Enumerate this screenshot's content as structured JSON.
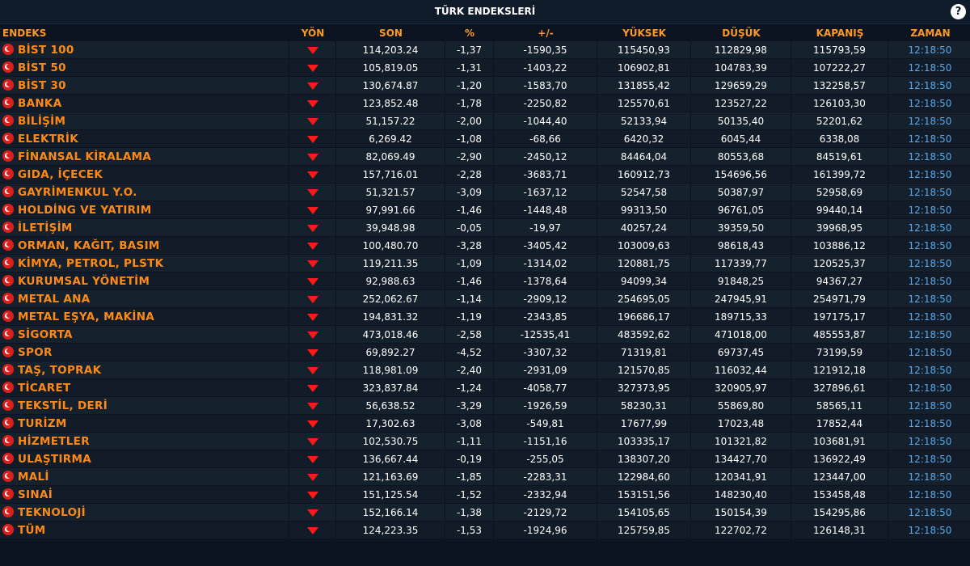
{
  "header": {
    "title": "TÜRK ENDEKSLERİ",
    "help_label": "?"
  },
  "columns": {
    "name": "ENDEKS",
    "direction": "YÖN",
    "last": "SON",
    "pct": "%",
    "change": "+/-",
    "high": "YÜKSEK",
    "low": "DÜŞÜK",
    "close": "KAPANIŞ",
    "time": "ZAMAN"
  },
  "colors": {
    "header_text": "#ff9a26",
    "name_text": "#ff8a1a",
    "down_arrow": "#ff1a1a",
    "time_text": "#5aa8e8",
    "flag": "#d9201c"
  },
  "icons": {
    "flag": "turkey-flag-icon",
    "direction": "down-arrow-icon",
    "help": "help-icon"
  },
  "rows": [
    {
      "name": "BİST 100",
      "direction": "down",
      "last": "114,203.24",
      "pct": "-1,37",
      "change": "-1590,35",
      "high": "115450,93",
      "low": "112829,98",
      "close": "115793,59",
      "time": "12:18:50"
    },
    {
      "name": "BİST 50",
      "direction": "down",
      "last": "105,819.05",
      "pct": "-1,31",
      "change": "-1403,22",
      "high": "106902,81",
      "low": "104783,39",
      "close": "107222,27",
      "time": "12:18:50"
    },
    {
      "name": "BİST 30",
      "direction": "down",
      "last": "130,674.87",
      "pct": "-1,20",
      "change": "-1583,70",
      "high": "131855,42",
      "low": "129659,29",
      "close": "132258,57",
      "time": "12:18:50"
    },
    {
      "name": "BANKA",
      "direction": "down",
      "last": "123,852.48",
      "pct": "-1,78",
      "change": "-2250,82",
      "high": "125570,61",
      "low": "123527,22",
      "close": "126103,30",
      "time": "12:18:50"
    },
    {
      "name": "BİLİŞİM",
      "direction": "down",
      "last": "51,157.22",
      "pct": "-2,00",
      "change": "-1044,40",
      "high": "52133,94",
      "low": "50135,40",
      "close": "52201,62",
      "time": "12:18:50"
    },
    {
      "name": "ELEKTRİK",
      "direction": "down",
      "last": "6,269.42",
      "pct": "-1,08",
      "change": "-68,66",
      "high": "6420,32",
      "low": "6045,44",
      "close": "6338,08",
      "time": "12:18:50"
    },
    {
      "name": "FİNANSAL KİRALAMA",
      "direction": "down",
      "last": "82,069.49",
      "pct": "-2,90",
      "change": "-2450,12",
      "high": "84464,04",
      "low": "80553,68",
      "close": "84519,61",
      "time": "12:18:50"
    },
    {
      "name": "GIDA, İÇECEK",
      "direction": "down",
      "last": "157,716.01",
      "pct": "-2,28",
      "change": "-3683,71",
      "high": "160912,73",
      "low": "154696,56",
      "close": "161399,72",
      "time": "12:18:50"
    },
    {
      "name": "GAYRİMENKUL Y.O.",
      "direction": "down",
      "last": "51,321.57",
      "pct": "-3,09",
      "change": "-1637,12",
      "high": "52547,58",
      "low": "50387,97",
      "close": "52958,69",
      "time": "12:18:50"
    },
    {
      "name": "HOLDİNG VE YATIRIM",
      "direction": "down",
      "last": "97,991.66",
      "pct": "-1,46",
      "change": "-1448,48",
      "high": "99313,50",
      "low": "96761,05",
      "close": "99440,14",
      "time": "12:18:50"
    },
    {
      "name": "İLETİŞİM",
      "direction": "down",
      "last": "39,948.98",
      "pct": "-0,05",
      "change": "-19,97",
      "high": "40257,24",
      "low": "39359,50",
      "close": "39968,95",
      "time": "12:18:50"
    },
    {
      "name": "ORMAN, KAĞIT, BASIM",
      "direction": "down",
      "last": "100,480.70",
      "pct": "-3,28",
      "change": "-3405,42",
      "high": "103009,63",
      "low": "98618,43",
      "close": "103886,12",
      "time": "12:18:50"
    },
    {
      "name": "KİMYA, PETROL, PLSTK",
      "direction": "down",
      "last": "119,211.35",
      "pct": "-1,09",
      "change": "-1314,02",
      "high": "120881,75",
      "low": "117339,77",
      "close": "120525,37",
      "time": "12:18:50"
    },
    {
      "name": "KURUMSAL YÖNETİM",
      "direction": "down",
      "last": "92,988.63",
      "pct": "-1,46",
      "change": "-1378,64",
      "high": "94099,34",
      "low": "91848,25",
      "close": "94367,27",
      "time": "12:18:50"
    },
    {
      "name": "METAL ANA",
      "direction": "down",
      "last": "252,062.67",
      "pct": "-1,14",
      "change": "-2909,12",
      "high": "254695,05",
      "low": "247945,91",
      "close": "254971,79",
      "time": "12:18:50"
    },
    {
      "name": "METAL EŞYA, MAKİNA",
      "direction": "down",
      "last": "194,831.32",
      "pct": "-1,19",
      "change": "-2343,85",
      "high": "196686,17",
      "low": "189715,33",
      "close": "197175,17",
      "time": "12:18:50"
    },
    {
      "name": "SİGORTA",
      "direction": "down",
      "last": "473,018.46",
      "pct": "-2,58",
      "change": "-12535,41",
      "high": "483592,62",
      "low": "471018,00",
      "close": "485553,87",
      "time": "12:18:50"
    },
    {
      "name": "SPOR",
      "direction": "down",
      "last": "69,892.27",
      "pct": "-4,52",
      "change": "-3307,32",
      "high": "71319,81",
      "low": "69737,45",
      "close": "73199,59",
      "time": "12:18:50"
    },
    {
      "name": "TAŞ, TOPRAK",
      "direction": "down",
      "last": "118,981.09",
      "pct": "-2,40",
      "change": "-2931,09",
      "high": "121570,85",
      "low": "116032,44",
      "close": "121912,18",
      "time": "12:18:50"
    },
    {
      "name": "TİCARET",
      "direction": "down",
      "last": "323,837.84",
      "pct": "-1,24",
      "change": "-4058,77",
      "high": "327373,95",
      "low": "320905,97",
      "close": "327896,61",
      "time": "12:18:50"
    },
    {
      "name": "TEKSTİL, DERİ",
      "direction": "down",
      "last": "56,638.52",
      "pct": "-3,29",
      "change": "-1926,59",
      "high": "58230,31",
      "low": "55869,80",
      "close": "58565,11",
      "time": "12:18:50"
    },
    {
      "name": "TURİZM",
      "direction": "down",
      "last": "17,302.63",
      "pct": "-3,08",
      "change": "-549,81",
      "high": "17677,99",
      "low": "17023,48",
      "close": "17852,44",
      "time": "12:18:50"
    },
    {
      "name": "HİZMETLER",
      "direction": "down",
      "last": "102,530.75",
      "pct": "-1,11",
      "change": "-1151,16",
      "high": "103335,17",
      "low": "101321,82",
      "close": "103681,91",
      "time": "12:18:50"
    },
    {
      "name": "ULAŞTIRMA",
      "direction": "down",
      "last": "136,667.44",
      "pct": "-0,19",
      "change": "-255,05",
      "high": "138307,20",
      "low": "134427,70",
      "close": "136922,49",
      "time": "12:18:50"
    },
    {
      "name": "MALİ",
      "direction": "down",
      "last": "121,163.69",
      "pct": "-1,85",
      "change": "-2283,31",
      "high": "122984,60",
      "low": "120341,91",
      "close": "123447,00",
      "time": "12:18:50"
    },
    {
      "name": "SINAİ",
      "direction": "down",
      "last": "151,125.54",
      "pct": "-1,52",
      "change": "-2332,94",
      "high": "153151,56",
      "low": "148230,40",
      "close": "153458,48",
      "time": "12:18:50"
    },
    {
      "name": "TEKNOLOJİ",
      "direction": "down",
      "last": "152,166.14",
      "pct": "-1,38",
      "change": "-2129,72",
      "high": "154105,65",
      "low": "150154,39",
      "close": "154295,86",
      "time": "12:18:50"
    },
    {
      "name": "TÜM",
      "direction": "down",
      "last": "124,223.35",
      "pct": "-1,53",
      "change": "-1924,96",
      "high": "125759,85",
      "low": "122702,72",
      "close": "126148,31",
      "time": "12:18:50"
    }
  ]
}
